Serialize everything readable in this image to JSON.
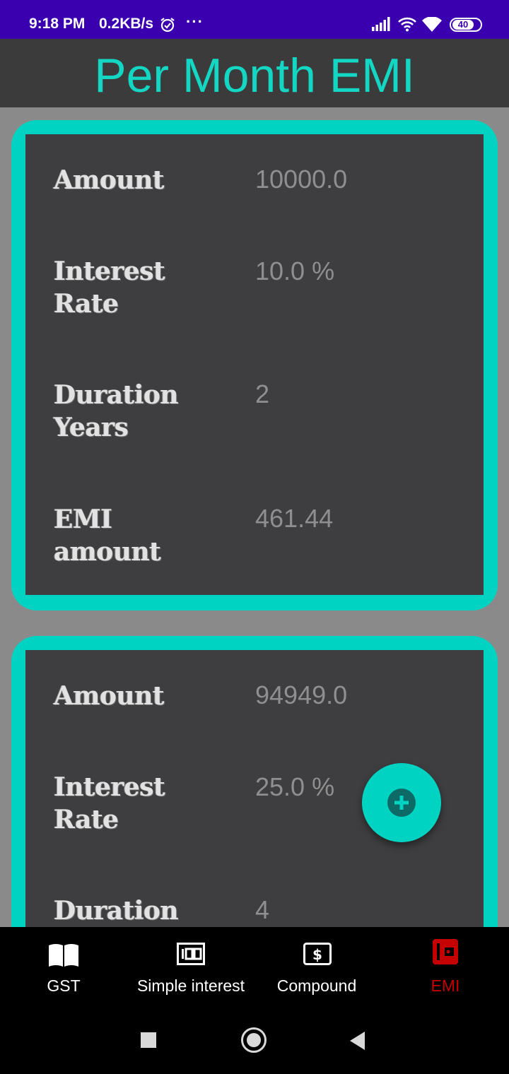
{
  "status_bar": {
    "time": "9:18 PM",
    "speed": "0.2KB/s",
    "more": "···",
    "battery": "40",
    "icons": [
      "alarm-icon",
      "signal-icon",
      "wifi-icon",
      "wifi-icon",
      "battery-icon"
    ]
  },
  "header": {
    "title": "Per Month EMI"
  },
  "cards": [
    {
      "amount_label": "Amount",
      "amount_value": "10000.0",
      "rate_label": "Interest Rate",
      "rate_value": "10.0 %",
      "duration_label": "Duration Years",
      "duration_value": "2",
      "emi_label": "EMI amount",
      "emi_value": "461.44"
    },
    {
      "amount_label": "Amount",
      "amount_value": "94949.0",
      "rate_label": "Interest Rate",
      "rate_value": "25.0 %",
      "duration_label": "Duration",
      "duration_value": "4"
    }
  ],
  "fab": {
    "icon": "add-icon"
  },
  "bottom_nav": {
    "items": [
      {
        "label": "GST",
        "icon": "book-icon",
        "active": false
      },
      {
        "label": "Simple interest",
        "icon": "hundred-icon",
        "active": false
      },
      {
        "label": "Compound",
        "icon": "dollar-icon",
        "active": false
      },
      {
        "label": "EMI",
        "icon": "wallet-icon",
        "active": true
      }
    ]
  },
  "colors": {
    "accent": "#00d3c2",
    "title": "#13d6c3",
    "status_bar": "#3a00b0",
    "active_nav": "#c40000",
    "card_bg": "#3e3e40",
    "page_bg": "#8a8a8a"
  }
}
